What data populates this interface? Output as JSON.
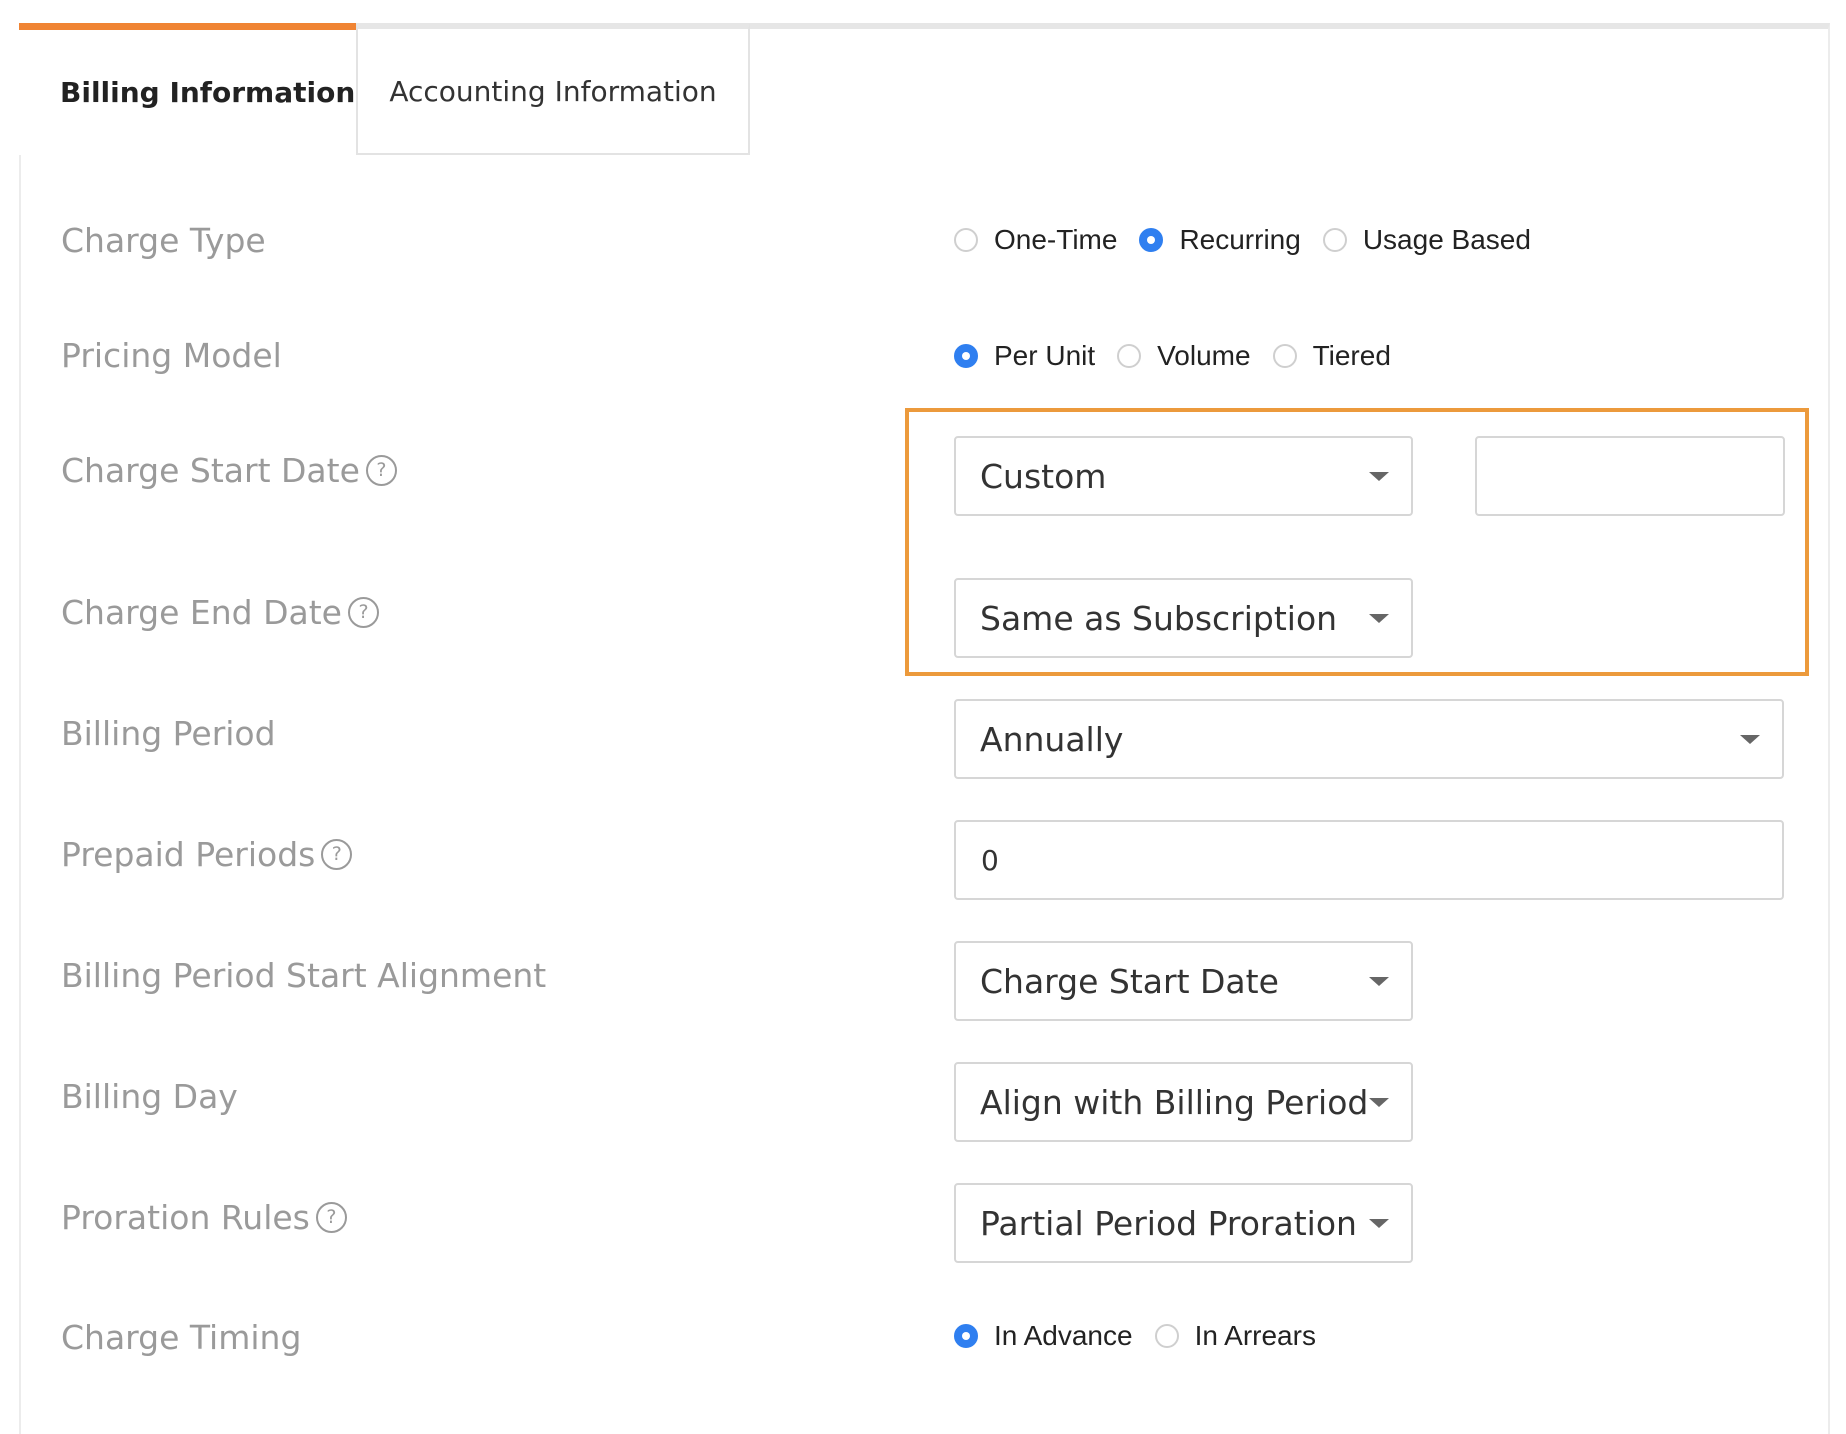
{
  "tabs": {
    "billing": "Billing Information",
    "accounting": "Accounting Information"
  },
  "fields": {
    "charge_type": {
      "label": "Charge Type",
      "options": [
        "One-Time",
        "Recurring",
        "Usage Based"
      ],
      "selected": "Recurring"
    },
    "pricing_model": {
      "label": "Pricing Model",
      "options": [
        "Per Unit",
        "Volume",
        "Tiered"
      ],
      "selected": "Per Unit"
    },
    "charge_start_date": {
      "label": "Charge Start Date",
      "value": "Custom",
      "date_value": ""
    },
    "charge_end_date": {
      "label": "Charge End Date",
      "value": "Same as Subscription"
    },
    "billing_period": {
      "label": "Billing Period",
      "value": "Annually"
    },
    "prepaid_periods": {
      "label": "Prepaid Periods",
      "value": "0"
    },
    "billing_period_start_alignment": {
      "label": "Billing Period Start Alignment",
      "value": "Charge Start Date"
    },
    "billing_day": {
      "label": "Billing Day",
      "value": "Align with Billing Period"
    },
    "proration_rules": {
      "label": "Proration Rules",
      "value": "Partial Period Proration"
    },
    "charge_timing": {
      "label": "Charge Timing",
      "options": [
        "In Advance",
        "In Arrears"
      ],
      "selected": "In Advance"
    }
  },
  "help_icon_glyph": "?",
  "colors": {
    "accent_tab": "#f08433",
    "radio_checked": "#2f7ff0",
    "highlight_border": "#ec9a3c"
  }
}
